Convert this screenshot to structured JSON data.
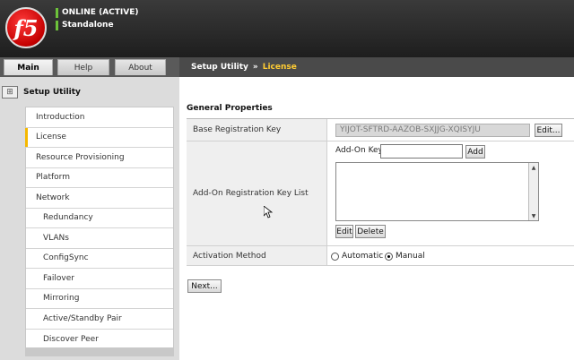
{
  "header": {
    "logo_text": "f5",
    "status": "ONLINE (ACTIVE)",
    "mode": "Standalone"
  },
  "tabs": [
    {
      "label": "Main",
      "active": true
    },
    {
      "label": "Help",
      "active": false
    },
    {
      "label": "About",
      "active": false
    }
  ],
  "breadcrumb": {
    "section": "Setup Utility",
    "separator": "»",
    "page": "License"
  },
  "sidebar": {
    "title": "Setup Utility",
    "items": [
      {
        "label": "Introduction",
        "sub": false
      },
      {
        "label": "License",
        "sub": false,
        "active": true
      },
      {
        "label": "Resource Provisioning",
        "sub": false
      },
      {
        "label": "Platform",
        "sub": false
      },
      {
        "label": "Network",
        "sub": false
      },
      {
        "label": "Redundancy",
        "sub": true
      },
      {
        "label": "VLANs",
        "sub": true
      },
      {
        "label": "ConfigSync",
        "sub": true
      },
      {
        "label": "Failover",
        "sub": true
      },
      {
        "label": "Mirroring",
        "sub": true
      },
      {
        "label": "Active/Standby Pair",
        "sub": true
      },
      {
        "label": "Discover Peer",
        "sub": true
      }
    ]
  },
  "main": {
    "section_title": "General Properties",
    "base_key_label": "Base Registration Key",
    "base_key_value": "YIJOT-SFTRD-AAZOB-SXJJG-XQISYJU",
    "edit_button": "Edit...",
    "addon_list_label": "Add-On Registration Key List",
    "addon_key_label": "Add-On Key",
    "addon_key_value": "",
    "add_button": "Add",
    "list_edit_button": "Edit",
    "list_delete_button": "Delete",
    "activation_label": "Activation Method",
    "activation_options": [
      {
        "label": "Automatic",
        "selected": false
      },
      {
        "label": "Manual",
        "selected": true
      }
    ],
    "next_button": "Next..."
  },
  "colors": {
    "header_bg": "#2b2b2b",
    "status_green": "#6dc23a",
    "breadcrumb_accent": "#ffcc33",
    "active_nav_marker": "#f5b800"
  }
}
